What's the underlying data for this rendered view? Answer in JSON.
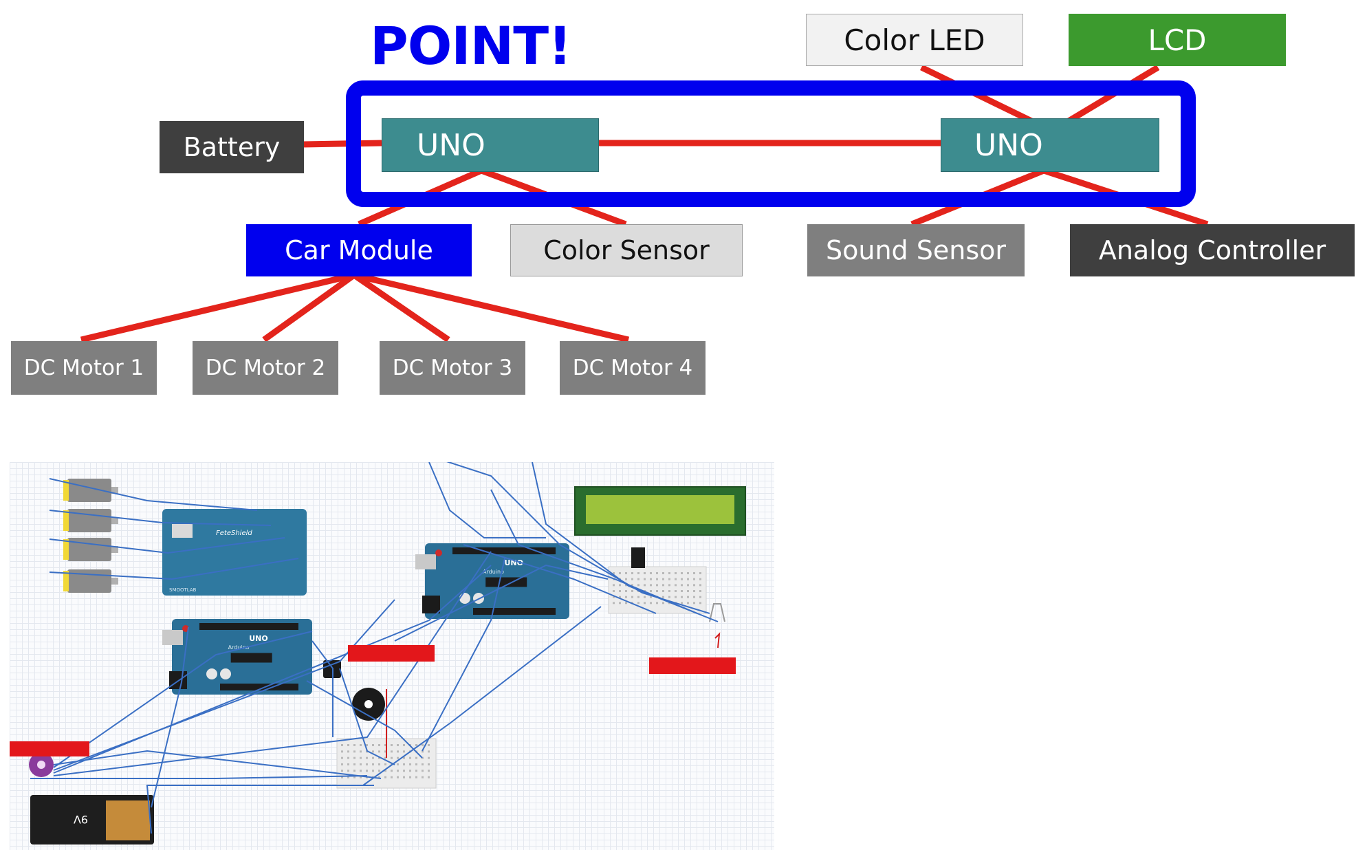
{
  "title": "POINT!",
  "nodes": {
    "battery": "Battery",
    "uno_left": "UNO",
    "uno_right": "UNO",
    "color_led": "Color LED",
    "lcd": "LCD",
    "car_module": "Car Module",
    "color_sensor": "Color Sensor",
    "sound_sensor": "Sound Sensor",
    "analog_controller": "Analog Controller",
    "dc_motor_1": "DC Motor 1",
    "dc_motor_2": "DC Motor 2",
    "dc_motor_3": "DC Motor 3",
    "dc_motor_4": "DC Motor 4"
  },
  "circuit": {
    "shield_label": "FeteShield",
    "shield_sublabel": "SMOOTLAB",
    "uno_badge": "UNO",
    "board_brand": "Arduino",
    "battery_label": "9V"
  },
  "colors": {
    "connector": "#e3241c",
    "highlight_frame": "#0000ee",
    "uno_box": "#3d8c8f",
    "car_module": "#0000ee",
    "lcd": "#3c9a2e",
    "color_led": "#f2f2f2",
    "color_sensor": "#dcdcdc",
    "sound_sensor": "#7f7f7f",
    "analog_controller": "#3f3f3f",
    "battery": "#3f3f3f",
    "dc_motor": "#7f7f7f",
    "wire": "#3a6fc4",
    "arduino_board": "#2a6f97",
    "annotation": "#e3171b"
  }
}
